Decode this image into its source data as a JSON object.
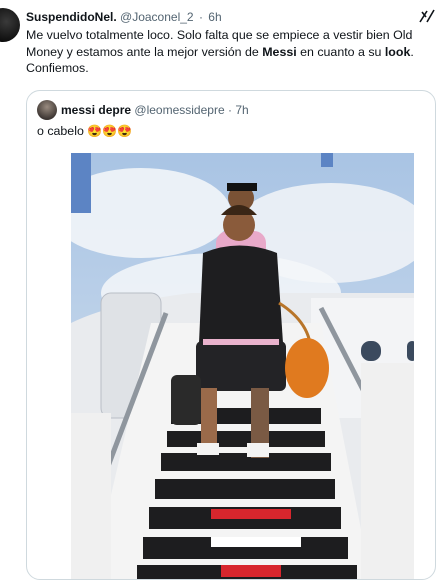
{
  "tweet": {
    "author_name": "SuspendidoNel.",
    "author_handle": "@Joaconel_2",
    "separator": "·",
    "time": "6h",
    "text_part1": "Me vuelvo totalmente loco. Solo falta que se empiece a vestir bien Old Money y estamos ante la mejor versión de ",
    "text_bold1": "Messi",
    "text_part2": " en cuanto a su ",
    "text_bold2": "look",
    "text_part3": ". Confiemos.",
    "grok_icon": "grok-icon"
  },
  "quoted_tweet": {
    "author_name": "messi depre",
    "author_handle": "@leomessidepre",
    "separator": "·",
    "time": "7h",
    "text": "o cabelo",
    "emojis": "😍😍😍",
    "image_description_icon": "photo"
  },
  "colors": {
    "text_primary": "#0f1419",
    "text_secondary": "#536471",
    "border": "#cfd9de"
  }
}
